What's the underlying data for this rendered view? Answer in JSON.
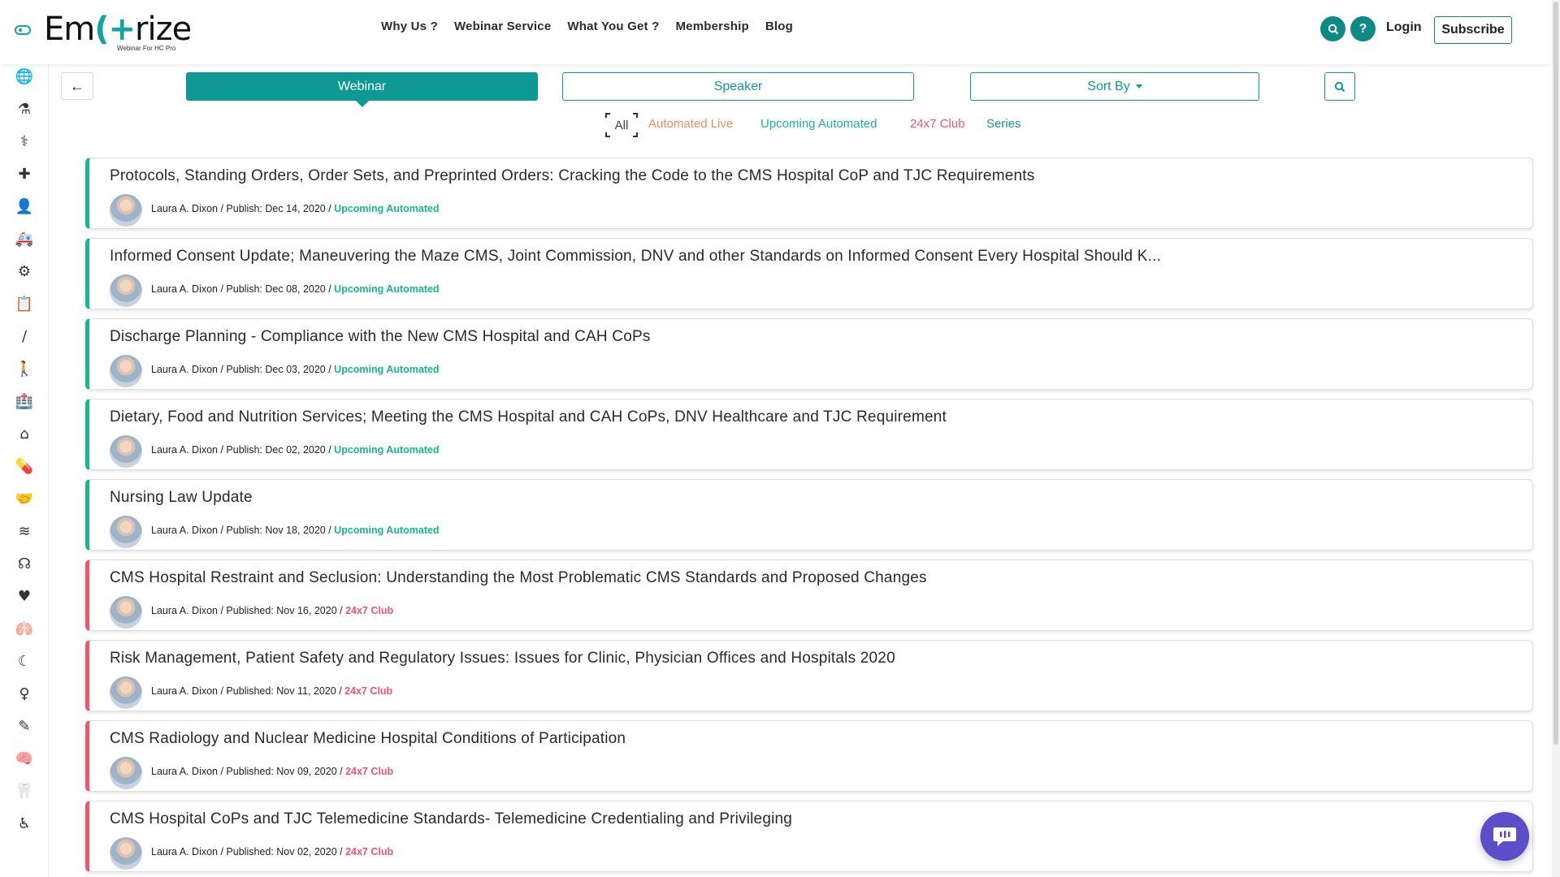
{
  "header": {
    "logo_text_a": "Em",
    "logo_text_b": "rize",
    "logo_tagline": "Webinar For HC Pro",
    "nav": [
      "Why Us ?",
      "Webinar Service",
      "What You Get ?",
      "Membership",
      "Blog"
    ],
    "help_label": "?",
    "login": "Login",
    "subscribe": "Subscribe"
  },
  "toolbar": {
    "back": "←",
    "tabs": [
      "Webinar",
      "Speaker",
      "Sort By"
    ],
    "filters": [
      "All",
      "Automated Live",
      "Upcoming Automated",
      "24x7 Club",
      "Series"
    ]
  },
  "colors": {
    "accent": "#0e9995",
    "green_status": "#16b889",
    "red_status": "#f0566b",
    "orange_filter": "#f08a5d",
    "chat": "#5c4dc9"
  },
  "sidebar_icons": [
    "globe-icon",
    "flask-icon",
    "caduceus-icon",
    "medkit-icon",
    "doctor-icon",
    "ambulance-icon",
    "user-cog-icon",
    "clipboard-icon",
    "syringe-icon",
    "person-icon",
    "hospital-icon",
    "home-medical-icon",
    "pill-bowl-icon",
    "handshake-icon",
    "spine-icon",
    "stethoscope-icon",
    "heartbeat-icon",
    "lungs-icon",
    "stomach-icon",
    "uterus-icon",
    "notes-icon",
    "brain-icon",
    "tooth-icon",
    "wheelchair-icon"
  ],
  "webinars": [
    {
      "title": "Protocols, Standing Orders, Order Sets, and Preprinted Orders: Cracking the Code to the CMS Hospital CoP and TJC Requirements",
      "speaker": "Laura A. Dixon",
      "publish_label": "Publish:",
      "date": "Dec 14, 2020",
      "status": "Upcoming Automated",
      "type": "green"
    },
    {
      "title": "Informed Consent Update; Maneuvering the Maze CMS, Joint Commission, DNV and other Standards on Informed Consent Every Hospital Should K...",
      "speaker": "Laura A. Dixon",
      "publish_label": "Publish:",
      "date": "Dec 08, 2020",
      "status": "Upcoming Automated",
      "type": "green"
    },
    {
      "title": "Discharge Planning - Compliance with the New CMS Hospital and CAH CoPs",
      "speaker": "Laura A. Dixon",
      "publish_label": "Publish:",
      "date": "Dec 03, 2020",
      "status": "Upcoming Automated",
      "type": "green"
    },
    {
      "title": "Dietary, Food and Nutrition Services; Meeting the CMS Hospital and CAH CoPs, DNV Healthcare and TJC Requirement",
      "speaker": "Laura A. Dixon",
      "publish_label": "Publish:",
      "date": "Dec 02, 2020",
      "status": "Upcoming Automated",
      "type": "green"
    },
    {
      "title": "Nursing Law Update",
      "speaker": "Laura A. Dixon",
      "publish_label": "Publish:",
      "date": "Nov 18, 2020",
      "status": "Upcoming Automated",
      "type": "green"
    },
    {
      "title": "CMS Hospital Restraint and Seclusion: Understanding the Most Problematic CMS Standards and Proposed Changes",
      "speaker": "Laura A. Dixon",
      "publish_label": "Published:",
      "date": "Nov 16, 2020",
      "status": "24x7 Club",
      "type": "red"
    },
    {
      "title": "Risk Management, Patient Safety and Regulatory Issues: Issues for Clinic, Physician Offices and Hospitals 2020",
      "speaker": "Laura A. Dixon",
      "publish_label": "Published:",
      "date": "Nov 11, 2020",
      "status": "24x7 Club",
      "type": "red"
    },
    {
      "title": "CMS Radiology and Nuclear Medicine Hospital Conditions of Participation",
      "speaker": "Laura A. Dixon",
      "publish_label": "Published:",
      "date": "Nov 09, 2020",
      "status": "24x7 Club",
      "type": "red"
    },
    {
      "title": "CMS Hospital CoPs and TJC Telemedicine Standards- Telemedicine Credentialing and Privileging",
      "speaker": "Laura A. Dixon",
      "publish_label": "Published:",
      "date": "Nov 02, 2020",
      "status": "24x7 Club",
      "type": "red"
    }
  ]
}
